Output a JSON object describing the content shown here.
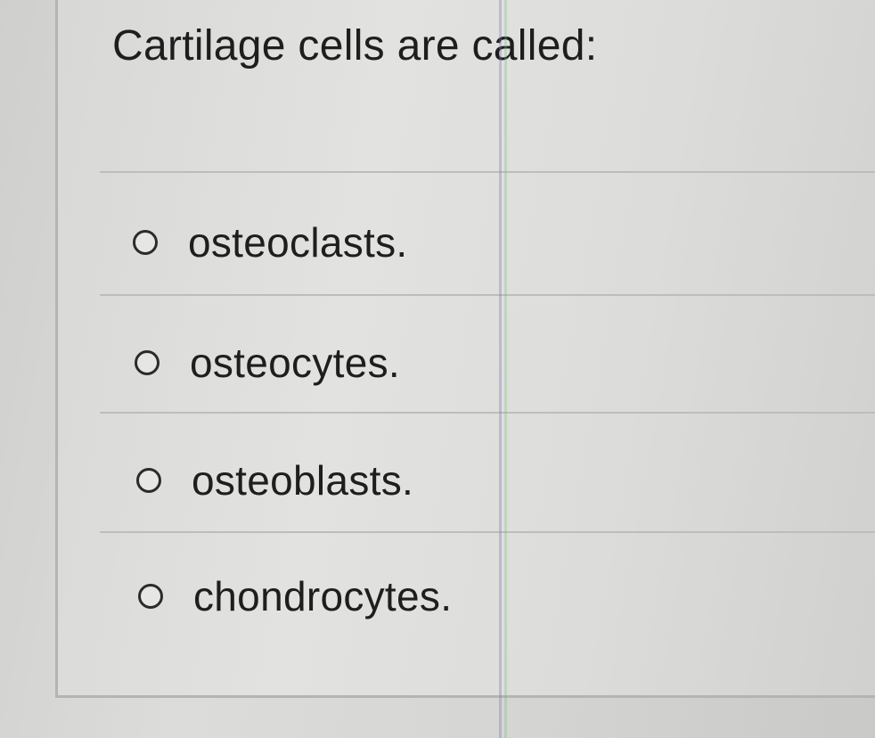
{
  "question": {
    "text": "Cartilage cells are called:"
  },
  "answers": [
    {
      "label": "osteoclasts.",
      "selected": false
    },
    {
      "label": "osteocytes.",
      "selected": false
    },
    {
      "label": "osteoblasts.",
      "selected": false
    },
    {
      "label": "chondrocytes.",
      "selected": false
    }
  ],
  "colors": {
    "text": "#1e1e1e",
    "radio_border": "#2b2b2b",
    "divider": "#bdbdbb"
  }
}
